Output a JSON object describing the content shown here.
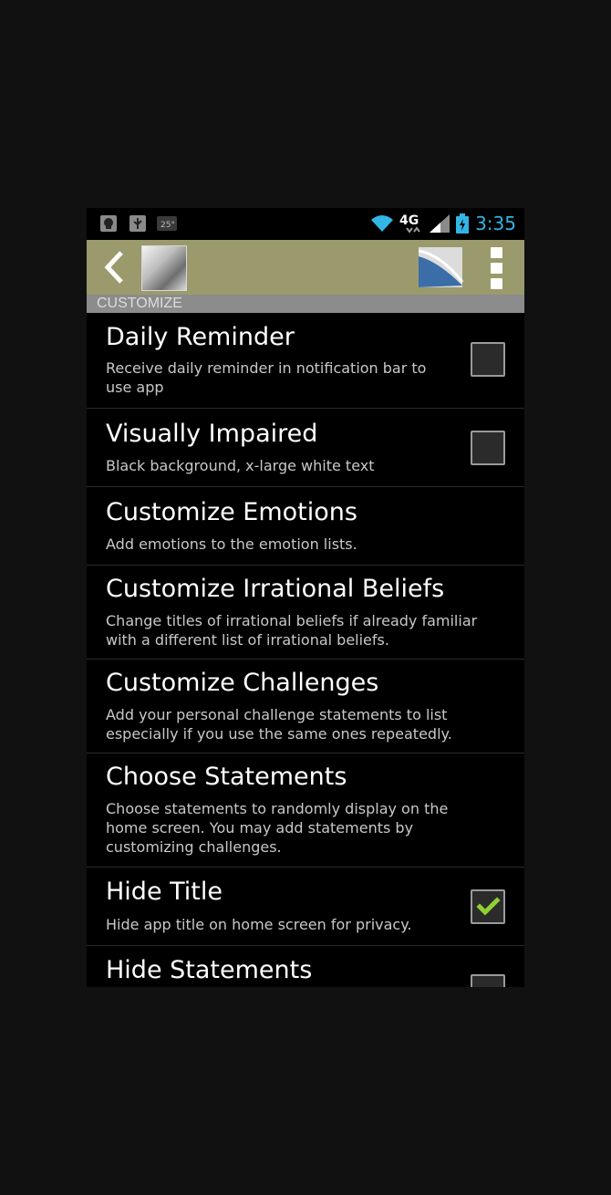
{
  "status_bar": {
    "time": "3:35",
    "network": "4G",
    "temp_badge": "25°",
    "icons": [
      "android-notification-icon",
      "usb-icon",
      "weather-icon",
      "wifi-icon",
      "4g-lte-icon",
      "signal-icon",
      "battery-charging-icon"
    ]
  },
  "action_bar": {
    "back_icon": "chevron-left-icon",
    "app_icon": "app-thumbnail",
    "action_icon": "chart-icon",
    "overflow_icon": "overflow-menu-icon"
  },
  "section": {
    "header": "CUSTOMIZE"
  },
  "preferences": [
    {
      "title": "Daily Reminder",
      "summary": "Receive daily reminder in notification bar to use app",
      "checkbox": true,
      "checked": false
    },
    {
      "title": "Visually Impaired",
      "summary": "Black background, x-large white text",
      "checkbox": true,
      "checked": false
    },
    {
      "title": "Customize Emotions",
      "summary": "Add emotions to the emotion lists.",
      "checkbox": false
    },
    {
      "title": "Customize Irrational Beliefs",
      "summary": "Change titles of irrational beliefs if already familiar with a different list of irrational beliefs.",
      "checkbox": false
    },
    {
      "title": "Customize Challenges",
      "summary": "Add your personal challenge statements to list especially if you use the same ones repeatedly.",
      "checkbox": false
    },
    {
      "title": "Choose Statements",
      "summary": "Choose statements to randomly display on the home screen. You may add statements by customizing challenges.",
      "checkbox": false
    },
    {
      "title": "Hide Title",
      "summary": "Hide app title on home screen for privacy.",
      "checkbox": true,
      "checked": true
    },
    {
      "title": "Hide Statements",
      "summary": "",
      "checkbox": true,
      "checked": false
    }
  ],
  "colors": {
    "action_bar": "#9a9a6c",
    "clock": "#33b5e5",
    "checkmark": "#8fd032"
  }
}
